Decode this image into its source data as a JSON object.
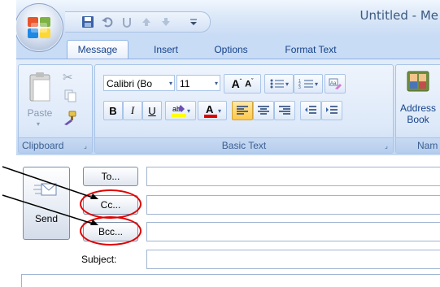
{
  "window": {
    "title": "Untitled - Me"
  },
  "tabs": [
    {
      "label": "Message",
      "active": true
    },
    {
      "label": "Insert",
      "active": false
    },
    {
      "label": "Options",
      "active": false
    },
    {
      "label": "Format Text",
      "active": false
    }
  ],
  "ribbon": {
    "clipboard": {
      "label": "Clipboard",
      "paste_label": "Paste"
    },
    "basic_text": {
      "label": "Basic Text",
      "font": "Calibri (Bo",
      "size": "11"
    },
    "names": {
      "label": "Nam",
      "address_book_line1": "Address",
      "address_book_line2": "Book"
    }
  },
  "compose": {
    "send_label": "Send",
    "to_label": "To...",
    "cc_label": "Cc...",
    "bcc_label": "Bcc...",
    "subject_label": "Subject:",
    "to_value": "",
    "cc_value": "",
    "bcc_value": "",
    "subject_value": ""
  },
  "colors": {
    "highlight": "#e00000",
    "ribbon_text": "#15428b",
    "font_color_bar": "#e00000",
    "highlight_bar": "#ffff00"
  }
}
